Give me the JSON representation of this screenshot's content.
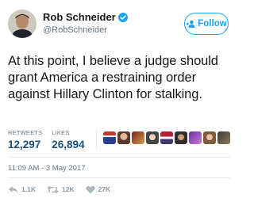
{
  "tweet": {
    "author": {
      "display_name": "Rob Schneider",
      "handle": "@RobSchneider",
      "verified_icon": "verified-badge-icon",
      "avatar": "avatar"
    },
    "follow_button": {
      "label": "Follow",
      "icon": "add-user-icon"
    },
    "text": "At this point, I believe a judge should grant America a restraining order against Hillary Clinton for stalking.",
    "stats": {
      "retweets_label": "RETWEETS",
      "retweets_value": "12,297",
      "likes_label": "LIKES",
      "likes_value": "26,894"
    },
    "timestamp": "11:09 AM - 3 May 2017",
    "actions": {
      "reply_count": "1.1K",
      "retweet_count": "12K",
      "like_count": "27K"
    }
  },
  "colors": {
    "accent": "#1da1f2",
    "text": "#14171a",
    "muted": "#657786",
    "stat_value": "#1b4f7a"
  }
}
